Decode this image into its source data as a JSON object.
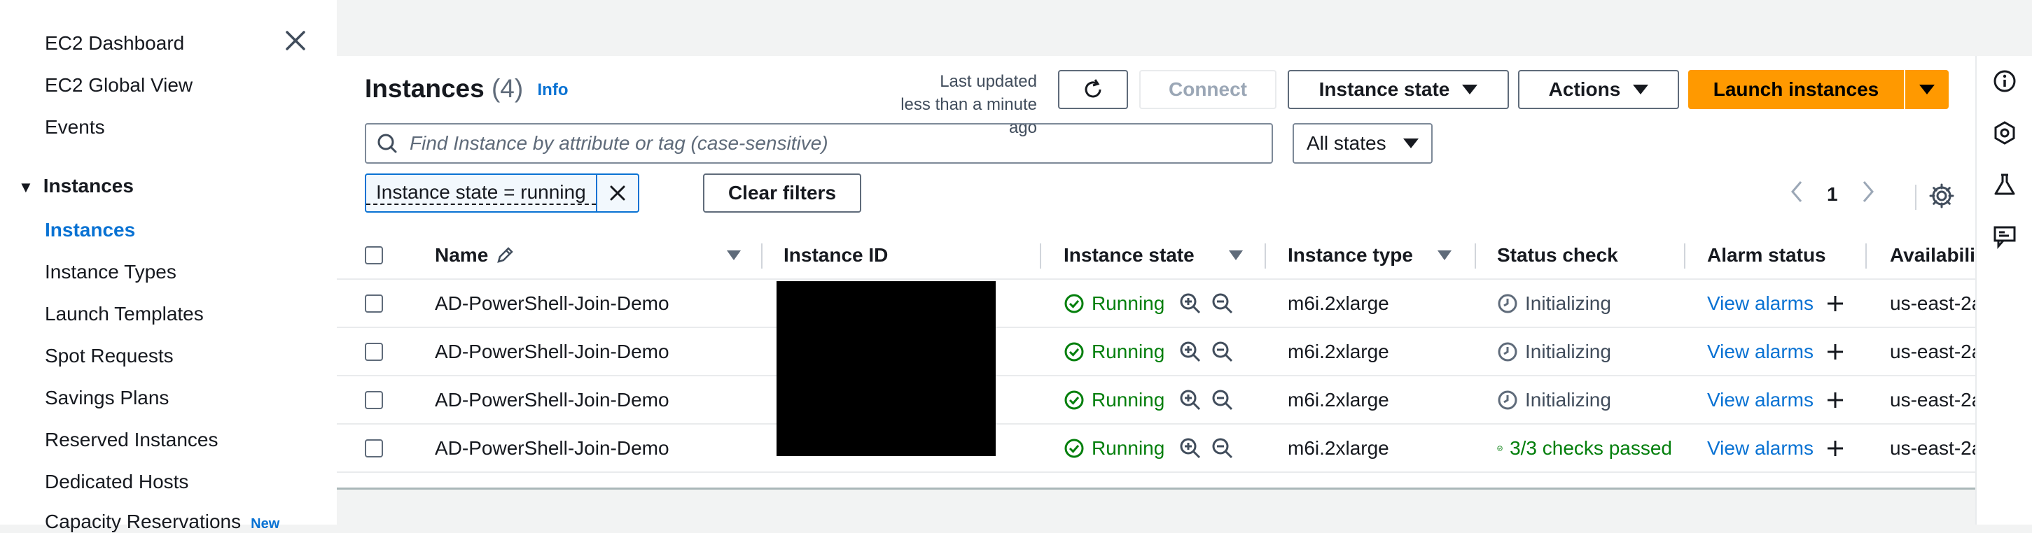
{
  "sidebar": {
    "items": [
      {
        "label": "EC2 Dashboard"
      },
      {
        "label": "EC2 Global View"
      },
      {
        "label": "Events"
      }
    ],
    "section": {
      "label": "Instances"
    },
    "section_items": [
      {
        "label": "Instances",
        "active": true
      },
      {
        "label": "Instance Types"
      },
      {
        "label": "Launch Templates"
      },
      {
        "label": "Spot Requests"
      },
      {
        "label": "Savings Plans"
      },
      {
        "label": "Reserved Instances"
      },
      {
        "label": "Dedicated Hosts"
      },
      {
        "label": "Capacity Reservations",
        "badge": "New"
      }
    ]
  },
  "header": {
    "title": "Instances",
    "count": "(4)",
    "info": "Info",
    "last_updated_line1": "Last updated",
    "last_updated_line2": "less than a minute ago",
    "connect": "Connect",
    "instance_state": "Instance state",
    "actions": "Actions",
    "launch": "Launch instances"
  },
  "filters": {
    "search_placeholder": "Find Instance by attribute or tag (case-sensitive)",
    "state_select": "All states",
    "token": "Instance state = running",
    "clear": "Clear filters"
  },
  "pagination": {
    "page": "1"
  },
  "table": {
    "columns": {
      "name": "Name",
      "instance_id": "Instance ID",
      "instance_state": "Instance state",
      "instance_type": "Instance type",
      "status_check": "Status check",
      "alarm_status": "Alarm status",
      "availability": "Availabili"
    },
    "rows": [
      {
        "name": "AD-PowerShell-Join-Demo",
        "state": "Running",
        "type": "m6i.2xlarge",
        "status": "Initializing",
        "alarm": "View alarms",
        "az": "us-east-2a"
      },
      {
        "name": "AD-PowerShell-Join-Demo",
        "state": "Running",
        "type": "m6i.2xlarge",
        "status": "Initializing",
        "alarm": "View alarms",
        "az": "us-east-2a"
      },
      {
        "name": "AD-PowerShell-Join-Demo",
        "state": "Running",
        "type": "m6i.2xlarge",
        "status": "Initializing",
        "alarm": "View alarms",
        "az": "us-east-2a"
      },
      {
        "name": "AD-PowerShell-Join-Demo",
        "state": "Running",
        "type": "m6i.2xlarge",
        "status": "3/3 checks passed",
        "alarm": "View alarms",
        "az": "us-east-2a"
      }
    ]
  },
  "colors": {
    "accent": "#0972d3",
    "primary": "#ff9900",
    "success": "#037f0c"
  }
}
